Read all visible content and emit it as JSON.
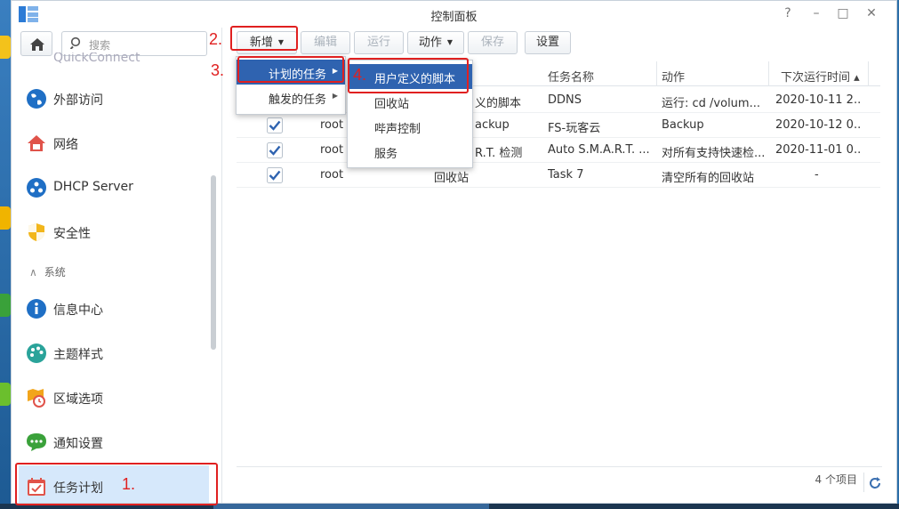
{
  "window": {
    "title": "控制面板",
    "help": "?",
    "minimize": "–",
    "maximize": "□",
    "close": "✕"
  },
  "sidebar": {
    "search_placeholder": "搜索",
    "items": [
      {
        "label": "QuickConnect"
      },
      {
        "label": "外部访问"
      },
      {
        "label": "网络"
      },
      {
        "label": "DHCP Server"
      },
      {
        "label": "安全性"
      },
      {
        "label": "信息中心"
      },
      {
        "label": "主题样式"
      },
      {
        "label": "区域选项"
      },
      {
        "label": "通知设置"
      },
      {
        "label": "任务计划"
      }
    ],
    "section_system": "系统"
  },
  "toolbar": {
    "new": "新增",
    "edit": "编辑",
    "run": "运行",
    "action": "动作",
    "save": "保存",
    "settings": "设置"
  },
  "table": {
    "columns": [
      "",
      "",
      "",
      "任务名称",
      "动作",
      "下次运行时间 ▴"
    ],
    "rows": [
      {
        "enabled": true,
        "user": "",
        "type": "义的脚本",
        "name": "DDNS",
        "action": "运行: cd /volum...",
        "next": "2020-10-11 2..."
      },
      {
        "enabled": true,
        "user": "root",
        "type": "ackup",
        "name": "FS-玩客云",
        "action": "Backup",
        "next": "2020-10-12 0..."
      },
      {
        "enabled": true,
        "user": "root",
        "type": "R.T. 检测",
        "name": "Auto S.M.A.R.T. ...",
        "action": "对所有支持快速检...",
        "next": "2020-11-01 0..."
      },
      {
        "enabled": true,
        "user": "root",
        "type": "回收站",
        "name": "Task 7",
        "action": "清空所有的回收站",
        "next": "-"
      }
    ]
  },
  "footer": {
    "count": "4 个项目"
  },
  "menu1": {
    "items": [
      "计划的任务",
      "触发的任务"
    ]
  },
  "menu2": {
    "items": [
      "用户定义的脚本",
      "回收站",
      "哔声控制",
      "服务"
    ]
  },
  "annotations": {
    "n1": "1.",
    "n2": "2.",
    "n3": "3.",
    "n4": "4."
  },
  "colors": {
    "accent": "#2f63b0",
    "annotation": "#e02020",
    "active_bg": "#d6e8fb"
  }
}
